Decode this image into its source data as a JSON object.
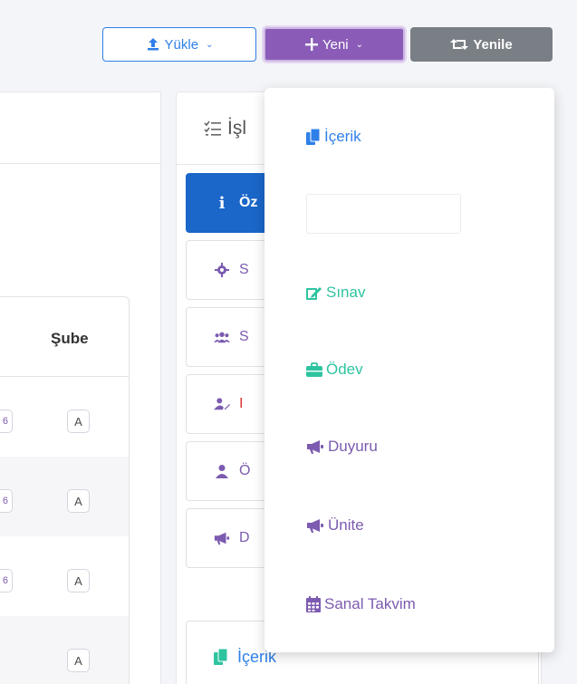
{
  "toolbar": {
    "upload_label": "Yükle",
    "new_label": "Yeni",
    "refresh_label": "Yenile"
  },
  "table": {
    "headers": [
      "Şube"
    ],
    "rows": [
      {
        "cut": "6",
        "sube": "A"
      },
      {
        "cut": "6",
        "sube": "A"
      },
      {
        "cut": "6",
        "sube": "A"
      },
      {
        "cut": "",
        "sube": "A"
      }
    ]
  },
  "right_panel": {
    "title": "İşl",
    "side_items": [
      {
        "label": "Öz",
        "icon": "info-icon",
        "active": true
      },
      {
        "label": "S",
        "icon": "gear-icon"
      },
      {
        "label": "S",
        "icon": "users-icon"
      },
      {
        "label": "I",
        "icon": "user-edit-icon"
      },
      {
        "label": "Ö",
        "icon": "user-icon"
      },
      {
        "label": "D",
        "icon": "megaphone-icon"
      }
    ],
    "bottom_label": "İçerik"
  },
  "dropdown": {
    "items": [
      {
        "label": "İçerik",
        "icon": "copy-icon",
        "color": "#2f80e8"
      },
      {
        "label": "Sınav",
        "icon": "edit-icon",
        "color": "#2ec4a0"
      },
      {
        "label": "Ödev",
        "icon": "briefcase-icon",
        "color": "#2ec4a0"
      },
      {
        "label": "Duyuru",
        "icon": "megaphone-icon",
        "color": "#7c5bb0"
      },
      {
        "label": "Ünite",
        "icon": "megaphone-icon",
        "color": "#7c5bb0"
      },
      {
        "label": "Sanal Takvim",
        "icon": "calendar-icon",
        "color": "#7c5bb0"
      }
    ]
  },
  "colors": {
    "primary": "#2f80e8",
    "purple": "#8a5cb8",
    "gray": "#7a7f86",
    "active_blue": "#1a66c9",
    "green": "#2ec4a0"
  }
}
